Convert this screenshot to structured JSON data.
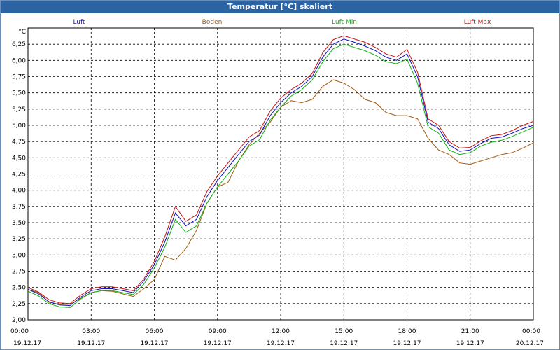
{
  "window": {
    "title": "Temperatur [°C] skaliert"
  },
  "chart_data": {
    "type": "line",
    "title": "Temperatur [°C] skaliert",
    "ylabel": "°C",
    "ylim": [
      2.0,
      6.5
    ],
    "xlim": [
      "19.12.17 00:00",
      "20.12.17 00:00"
    ],
    "grid": true,
    "legend_position": "top",
    "yticks": [
      "2,00",
      "2,25",
      "2,50",
      "2,75",
      "3,00",
      "3,25",
      "3,50",
      "3,75",
      "4,00",
      "4,25",
      "4,50",
      "4,75",
      "5,00",
      "5,25",
      "5,50",
      "5,75",
      "6,00",
      "6,25"
    ],
    "xticks": [
      {
        "time": "00:00",
        "date": "19.12.17"
      },
      {
        "time": "03:00",
        "date": "19.12.17"
      },
      {
        "time": "06:00",
        "date": "19.12.17"
      },
      {
        "time": "09:00",
        "date": "19.12.17"
      },
      {
        "time": "12:00",
        "date": "19.12.17"
      },
      {
        "time": "15:00",
        "date": "19.12.17"
      },
      {
        "time": "18:00",
        "date": "19.12.17"
      },
      {
        "time": "21:00",
        "date": "19.12.17"
      },
      {
        "time": "00:00",
        "date": "20.12.17"
      }
    ],
    "x": [
      "00:00",
      "00:30",
      "01:00",
      "01:30",
      "02:00",
      "02:30",
      "03:00",
      "03:30",
      "04:00",
      "04:30",
      "05:00",
      "05:30",
      "06:00",
      "06:30",
      "07:00",
      "07:30",
      "08:00",
      "08:30",
      "09:00",
      "09:30",
      "10:00",
      "10:30",
      "11:00",
      "11:30",
      "12:00",
      "12:30",
      "13:00",
      "13:30",
      "14:00",
      "14:30",
      "15:00",
      "15:30",
      "16:00",
      "16:30",
      "17:00",
      "17:30",
      "18:00",
      "18:30",
      "19:00",
      "19:30",
      "20:00",
      "20:30",
      "21:00",
      "21:30",
      "22:00",
      "22:30",
      "23:00",
      "23:30",
      "24:00"
    ],
    "series": [
      {
        "name": "Luft",
        "color": "#1010c8",
        "values": [
          2.47,
          2.4,
          2.28,
          2.23,
          2.22,
          2.35,
          2.45,
          2.48,
          2.48,
          2.45,
          2.42,
          2.6,
          2.85,
          3.2,
          3.65,
          3.45,
          3.55,
          3.9,
          4.15,
          4.35,
          4.55,
          4.75,
          4.85,
          5.15,
          5.35,
          5.5,
          5.6,
          5.75,
          6.05,
          6.25,
          6.33,
          6.28,
          6.22,
          6.15,
          6.05,
          6.0,
          6.1,
          5.75,
          5.05,
          4.95,
          4.7,
          4.6,
          4.62,
          4.72,
          4.8,
          4.82,
          4.88,
          4.95,
          5.0
        ]
      },
      {
        "name": "Boden",
        "color": "#a05a10",
        "values": [
          2.47,
          2.42,
          2.27,
          2.24,
          2.24,
          2.33,
          2.42,
          2.45,
          2.44,
          2.4,
          2.36,
          2.48,
          2.62,
          2.98,
          2.92,
          3.1,
          3.38,
          3.8,
          4.05,
          4.12,
          4.45,
          4.7,
          4.88,
          5.05,
          5.28,
          5.38,
          5.35,
          5.4,
          5.6,
          5.7,
          5.65,
          5.55,
          5.4,
          5.35,
          5.2,
          5.15,
          5.15,
          5.1,
          4.8,
          4.62,
          4.55,
          4.42,
          4.4,
          4.45,
          4.5,
          4.55,
          4.58,
          4.65,
          4.73
        ]
      },
      {
        "name": "Luft Min",
        "color": "#10b010",
        "values": [
          2.44,
          2.37,
          2.25,
          2.2,
          2.19,
          2.32,
          2.42,
          2.45,
          2.45,
          2.42,
          2.39,
          2.55,
          2.8,
          3.12,
          3.55,
          3.35,
          3.45,
          3.8,
          4.05,
          4.25,
          4.45,
          4.68,
          4.78,
          5.08,
          5.28,
          5.45,
          5.55,
          5.7,
          5.98,
          6.18,
          6.25,
          6.2,
          6.15,
          6.08,
          5.98,
          5.95,
          6.02,
          5.65,
          4.98,
          4.88,
          4.62,
          4.55,
          4.58,
          4.68,
          4.74,
          4.77,
          4.83,
          4.9,
          4.97
        ]
      },
      {
        "name": "Luft Max",
        "color": "#c81010",
        "values": [
          2.5,
          2.43,
          2.31,
          2.26,
          2.25,
          2.38,
          2.48,
          2.51,
          2.51,
          2.48,
          2.45,
          2.63,
          2.9,
          3.28,
          3.75,
          3.52,
          3.62,
          3.98,
          4.22,
          4.42,
          4.62,
          4.82,
          4.92,
          5.22,
          5.42,
          5.55,
          5.65,
          5.8,
          6.12,
          6.32,
          6.38,
          6.33,
          6.28,
          6.2,
          6.1,
          6.05,
          6.17,
          5.82,
          5.1,
          5.0,
          4.75,
          4.65,
          4.66,
          4.76,
          4.84,
          4.86,
          4.92,
          5.0,
          5.06
        ]
      }
    ]
  }
}
